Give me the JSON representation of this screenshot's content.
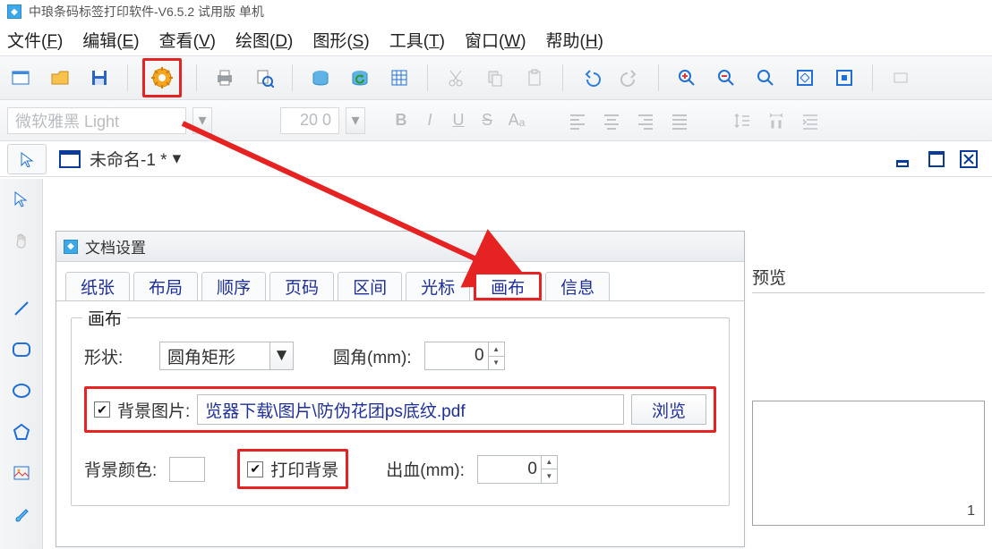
{
  "app": {
    "title": "中琅条码标签打印软件-V6.5.2 试用版 单机"
  },
  "menu": {
    "file": "文件(",
    "file_u": "F",
    "file2": ")",
    "edit": "编辑(",
    "edit_u": "E",
    "edit2": ")",
    "view": "查看(",
    "view_u": "V",
    "view2": ")",
    "draw": "绘图(",
    "draw_u": "D",
    "draw2": ")",
    "shape": "图形(",
    "shape_u": "S",
    "shape2": ")",
    "tools": "工具(",
    "tools_u": "T",
    "tools2": ")",
    "window": "窗口(",
    "window_u": "W",
    "window2": ")",
    "help": "帮助(",
    "help_u": "H",
    "help2": ")"
  },
  "toolbar2": {
    "font": "微软雅黑 Light",
    "size": "20 0"
  },
  "doc": {
    "title": "未命名-1 *"
  },
  "dialog": {
    "title": "文档设置",
    "tabs": {
      "paper": "纸张",
      "layout": "布局",
      "order": "顺序",
      "page": "页码",
      "range": "区间",
      "cursor": "光标",
      "canvas": "画布",
      "info": "信息"
    },
    "canvas": {
      "legend": "画布",
      "shape_label": "形状:",
      "shape_value": "圆角矩形",
      "radius_label": "圆角(mm):",
      "radius_value": "0",
      "bgimg_label": "背景图片:",
      "bgimg_path": "览器下载\\图片\\防伪花团ps底纹.pdf",
      "browse": "浏览",
      "bgcolor_label": "背景颜色:",
      "printbg_label": "打印背景",
      "bleed_label": "出血(mm):",
      "bleed_value": "0"
    }
  },
  "preview": {
    "title": "预览",
    "page": "1"
  }
}
